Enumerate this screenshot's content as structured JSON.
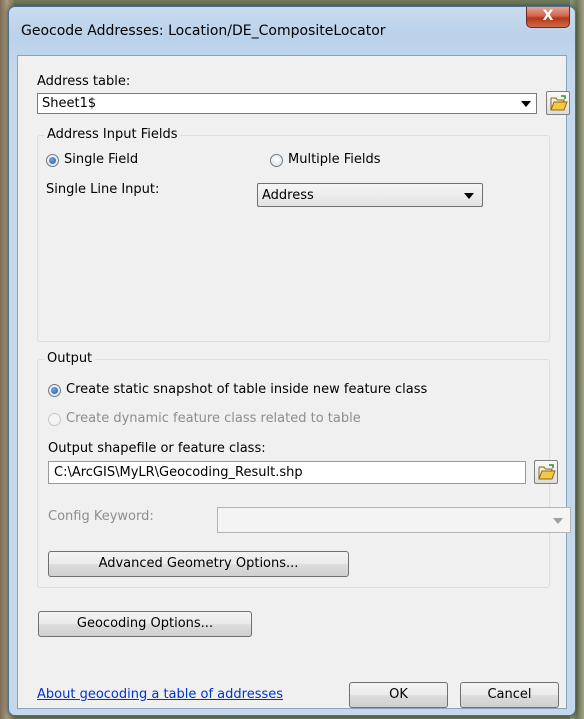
{
  "window": {
    "title": "Geocode Addresses:  Location/DE_CompositeLocator",
    "close_glyph": "X"
  },
  "address_table": {
    "label": "Address table:",
    "selected": "Sheet1$"
  },
  "input_fields": {
    "group_title": "Address Input Fields",
    "single_field_label": "Single Field",
    "multiple_fields_label": "Multiple Fields",
    "single_line_label": "Single Line Input:",
    "single_line_selected": "Address"
  },
  "output": {
    "group_title": "Output",
    "static_label": "Create static snapshot of table inside new feature class",
    "dynamic_label": "Create dynamic feature class related to table",
    "shapefile_label": "Output shapefile or feature class:",
    "shapefile_value": "C:\\ArcGIS\\MyLR\\Geocoding_Result.shp",
    "config_label": "Config Keyword:",
    "config_value": "",
    "advanced_button": "Advanced Geometry Options..."
  },
  "geocoding_options_button": "Geocoding Options...",
  "help_link": "About geocoding a table of addresses",
  "ok_button": "OK",
  "cancel_button": "Cancel",
  "colors": {
    "link": "#0033cc",
    "title_bar": "#c9dcef",
    "close_button": "#c94d2e"
  },
  "icons": {
    "close": "close-icon",
    "folder": "open-folder-icon",
    "dropdown": "chevron-down-icon"
  }
}
